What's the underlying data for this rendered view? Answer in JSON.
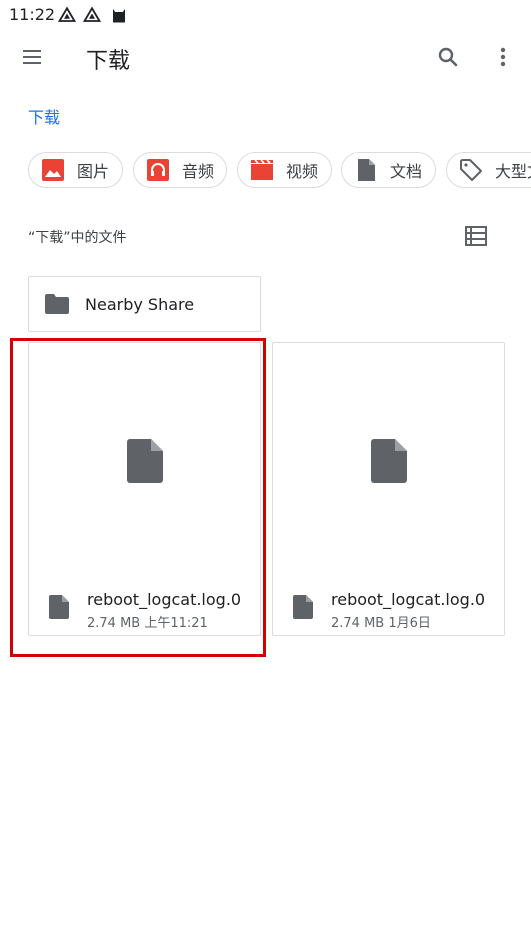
{
  "status_bar": {
    "time": "11:22",
    "icons": [
      "drive-icon",
      "drive-icon",
      "android-icon"
    ]
  },
  "app_bar": {
    "title": "下载",
    "icons": [
      "menu-icon",
      "search-icon",
      "more-vert-icon"
    ]
  },
  "breadcrumb": "下载",
  "chips": [
    {
      "label": "图片",
      "icon": "image-icon",
      "color": "#ea4335"
    },
    {
      "label": "音频",
      "icon": "headphones-icon",
      "color": "#ea4335"
    },
    {
      "label": "视频",
      "icon": "movie-icon",
      "color": "#ea4335"
    },
    {
      "label": "文档",
      "icon": "document-icon",
      "color": "#5f6368"
    },
    {
      "label": "大型文",
      "icon": "label-icon",
      "color": "#5f6368"
    }
  ],
  "section_title": "“下载”中的文件",
  "folder": {
    "name": "Nearby Share",
    "icon": "folder-icon"
  },
  "files": [
    {
      "name": "reboot_logcat.log.0",
      "size": "2.74 MB",
      "date": "上午11:21"
    },
    {
      "name": "reboot_logcat.log.0",
      "size": "2.74 MB",
      "date": "1月6日"
    }
  ],
  "colors": {
    "accent": "#1a73e8",
    "chip_red": "#ea4335",
    "icon_gray": "#5f6368",
    "highlight": "#d50000"
  }
}
